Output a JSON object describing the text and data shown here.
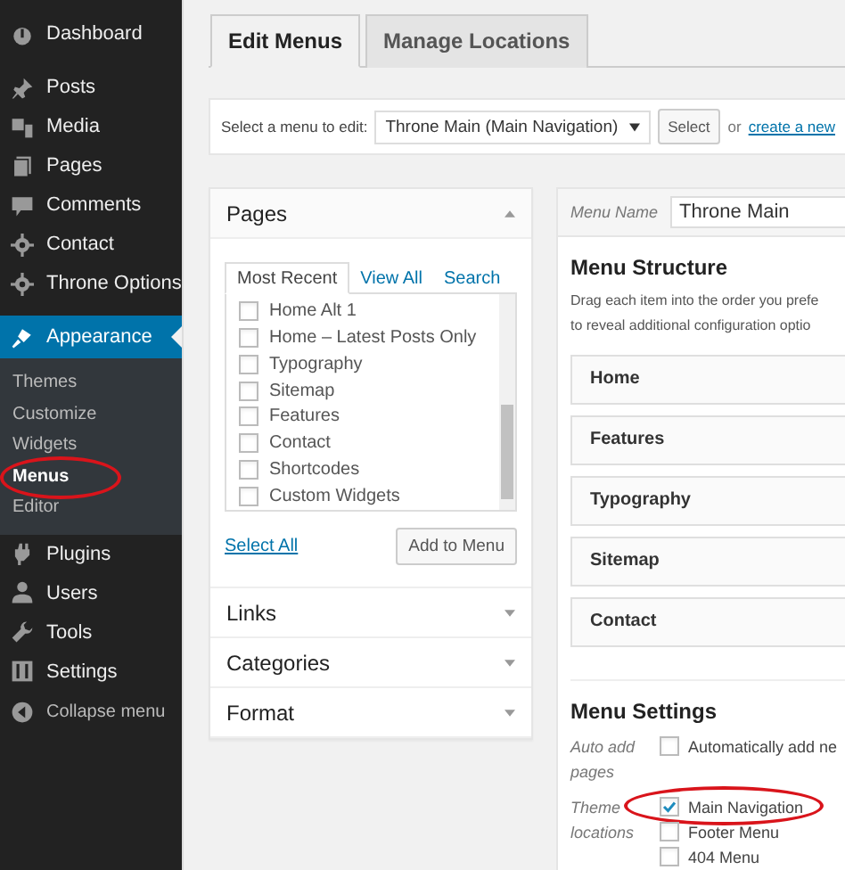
{
  "sidebar": {
    "items": [
      {
        "label": "Dashboard",
        "selected": false
      },
      {
        "label": "Posts",
        "selected": false
      },
      {
        "label": "Media",
        "selected": false
      },
      {
        "label": "Pages",
        "selected": false
      },
      {
        "label": "Comments",
        "selected": false
      },
      {
        "label": "Contact",
        "selected": false
      },
      {
        "label": "Throne Options",
        "selected": false
      },
      {
        "label": "Appearance",
        "selected": true,
        "submenu": [
          {
            "label": "Themes",
            "selected": false,
            "circled": false
          },
          {
            "label": "Customize",
            "selected": false,
            "circled": false
          },
          {
            "label": "Widgets",
            "selected": false,
            "circled": false
          },
          {
            "label": "Menus",
            "selected": true,
            "circled": true
          },
          {
            "label": "Editor",
            "selected": false,
            "circled": false
          }
        ]
      },
      {
        "label": "Plugins",
        "selected": false
      },
      {
        "label": "Users",
        "selected": false
      },
      {
        "label": "Tools",
        "selected": false
      },
      {
        "label": "Settings",
        "selected": false
      }
    ],
    "collapse": "Collapse menu"
  },
  "tabs": [
    {
      "label": "Edit Menus",
      "selected": true
    },
    {
      "label": "Manage Locations",
      "selected": false
    }
  ],
  "menu_select": {
    "label": "Select a menu to edit:",
    "value": "Throne Main (Main Navigation)",
    "button": "Select",
    "or_text": "or",
    "create_link": "create a new"
  },
  "pages_box": {
    "title": "Pages",
    "expanded": true,
    "tabs": [
      {
        "label": "Most Recent",
        "selected": true
      },
      {
        "label": "View All",
        "selected": false
      },
      {
        "label": "Search",
        "selected": false
      }
    ],
    "items": [
      {
        "label": "Home Alt 1",
        "checked": false
      },
      {
        "label": "Home – Latest Posts Only",
        "checked": false
      },
      {
        "label": "Typography",
        "checked": false
      },
      {
        "label": "Sitemap",
        "checked": false
      },
      {
        "label": "Features",
        "checked": false
      },
      {
        "label": "Contact",
        "checked": false
      },
      {
        "label": "Shortcodes",
        "checked": false
      },
      {
        "label": "Custom Widgets",
        "checked": false
      }
    ],
    "select_all": "Select All",
    "add_button": "Add to Menu"
  },
  "accordion": [
    {
      "title": "Links",
      "expanded": false
    },
    {
      "title": "Categories",
      "expanded": false
    },
    {
      "title": "Format",
      "expanded": false
    }
  ],
  "menu_name": {
    "label": "Menu Name",
    "value": "Throne Main"
  },
  "structure": {
    "title": "Menu Structure",
    "lines": [
      "Drag each item into the order you prefe",
      "to reveal additional configuration optio"
    ],
    "items": [
      "Home",
      "Features",
      "Typography",
      "Sitemap",
      "Contact"
    ]
  },
  "settings": {
    "title": "Menu Settings",
    "auto_add": {
      "label": "Auto add pages",
      "option": "Automatically add ne",
      "checked": false
    },
    "locations": {
      "label": "Theme locations",
      "options": [
        {
          "label": "Main Navigation",
          "checked": true,
          "circled": true
        },
        {
          "label": "Footer Menu",
          "checked": false,
          "circled": false
        },
        {
          "label": "404 Menu",
          "checked": false,
          "circled": false
        }
      ]
    }
  }
}
